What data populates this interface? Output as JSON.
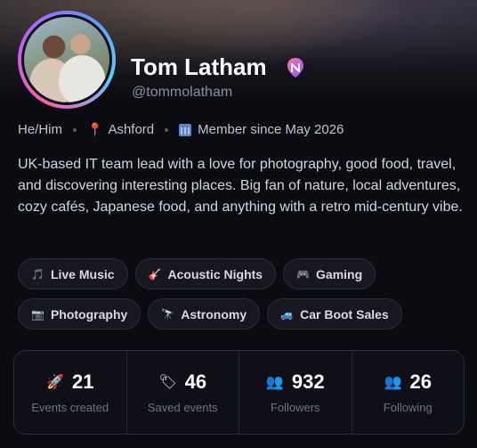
{
  "profile": {
    "name": "Tom Latham",
    "handle": "@tommolatham",
    "pronouns": "He/Him",
    "location": "Ashford",
    "member_since": "Member since May 2026",
    "bio": "UK-based IT team lead with a love for photography, good food, travel, and discovering interesting places. Big fan of nature, local adventures, cozy cafés, Japanese food, and anything with a retro mid-century vibe."
  },
  "tags": [
    {
      "icon": "music-note-icon",
      "glyph": "🎵",
      "label": "Live Music"
    },
    {
      "icon": "guitar-icon",
      "glyph": "🎸",
      "label": "Acoustic Nights"
    },
    {
      "icon": "gamepad-icon",
      "glyph": "🎮",
      "label": "Gaming"
    },
    {
      "icon": "camera-icon",
      "glyph": "📷",
      "label": "Photography"
    },
    {
      "icon": "telescope-icon",
      "glyph": "🔭",
      "label": "Astronomy"
    },
    {
      "icon": "car-icon",
      "glyph": "🚙",
      "label": "Car Boot Sales"
    }
  ],
  "stats": [
    {
      "icon": "rocket-icon",
      "glyph": "🚀",
      "value": "21",
      "label": "Events created"
    },
    {
      "icon": "tag-icon",
      "glyph": "🏷",
      "value": "46",
      "label": "Saved events"
    },
    {
      "icon": "people-icon",
      "glyph": "👥",
      "value": "932",
      "label": "Followers"
    },
    {
      "icon": "people-icon",
      "glyph": "👥",
      "value": "26",
      "label": "Following"
    }
  ],
  "colors": {
    "background": "#0b0c12",
    "accent_pink": "#ff5fa8",
    "accent_blue": "#4fd1ff",
    "verified_badge": "#b95cf0"
  }
}
